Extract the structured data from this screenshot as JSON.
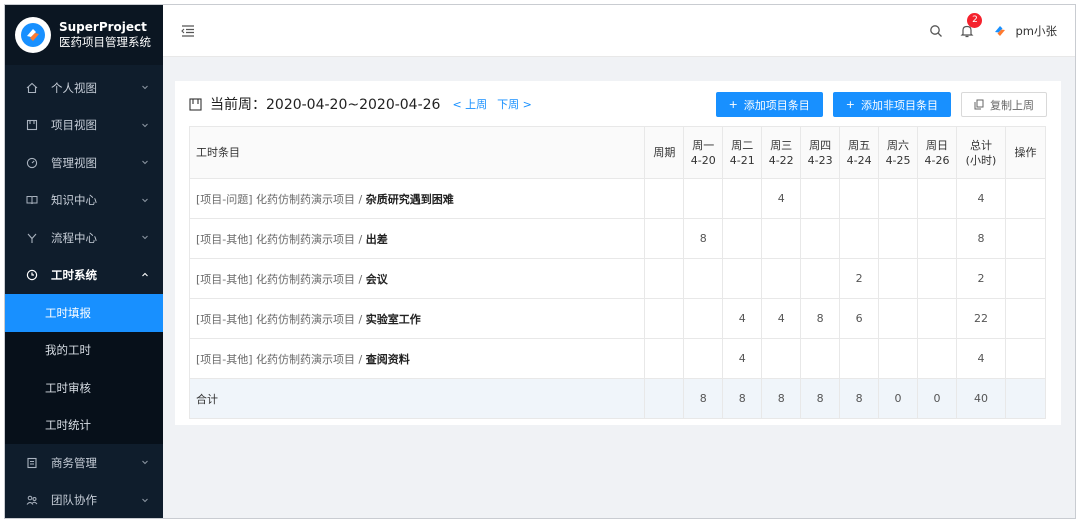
{
  "brand": {
    "title": "SuperProject",
    "subtitle": "医药项目管理系统"
  },
  "sidebar": {
    "items": [
      {
        "label": "个人视图",
        "icon": "home-icon"
      },
      {
        "label": "项目视图",
        "icon": "project-icon"
      },
      {
        "label": "管理视图",
        "icon": "dashboard-icon"
      },
      {
        "label": "知识中心",
        "icon": "book-icon"
      },
      {
        "label": "流程中心",
        "icon": "flow-icon"
      },
      {
        "label": "工时系统",
        "icon": "clock-icon"
      }
    ],
    "sub_items": [
      {
        "label": "工时填报"
      },
      {
        "label": "我的工时"
      },
      {
        "label": "工时审核"
      },
      {
        "label": "工时统计"
      }
    ],
    "bottom_items": [
      {
        "label": "商务管理",
        "icon": "business-icon"
      },
      {
        "label": "团队协作",
        "icon": "team-icon"
      }
    ]
  },
  "topbar": {
    "notification_count": "2",
    "user_name": "pm小张"
  },
  "week": {
    "label": "当前周：2020-04-20~2020-04-26",
    "prev": "< 上周",
    "next": "下周 >"
  },
  "buttons": {
    "add_project": "添加项目条目",
    "add_non_project": "添加非项目条目",
    "copy_last": "复制上周"
  },
  "table": {
    "headers": {
      "item": "工时条目",
      "period": "周期",
      "days": [
        {
          "day": "周一",
          "date": "4-20"
        },
        {
          "day": "周二",
          "date": "4-21"
        },
        {
          "day": "周三",
          "date": "4-22"
        },
        {
          "day": "周四",
          "date": "4-23"
        },
        {
          "day": "周五",
          "date": "4-24"
        },
        {
          "day": "周六",
          "date": "4-25"
        },
        {
          "day": "周日",
          "date": "4-26"
        }
      ],
      "total_line1": "总计",
      "total_line2": "(小时)",
      "action": "操作"
    },
    "rows": [
      {
        "prefix": "[项目-问题] 化药仿制药演示项目 / ",
        "title": "杂质研究遇到困难",
        "period": "",
        "hours": [
          "",
          "",
          "4",
          "",
          "",
          "",
          ""
        ],
        "total": "4"
      },
      {
        "prefix": "[项目-其他] 化药仿制药演示项目 / ",
        "title": "出差",
        "period": "",
        "hours": [
          "8",
          "",
          "",
          "",
          "",
          "",
          ""
        ],
        "total": "8"
      },
      {
        "prefix": "[项目-其他] 化药仿制药演示项目 / ",
        "title": "会议",
        "period": "",
        "hours": [
          "",
          "",
          "",
          "",
          "2",
          "",
          ""
        ],
        "total": "2"
      },
      {
        "prefix": "[项目-其他] 化药仿制药演示项目 / ",
        "title": "实验室工作",
        "period": "",
        "hours": [
          "",
          "4",
          "4",
          "8",
          "6",
          "",
          ""
        ],
        "total": "22"
      },
      {
        "prefix": "[项目-其他] 化药仿制药演示项目 / ",
        "title": "查阅资料",
        "period": "",
        "hours": [
          "",
          "4",
          "",
          "",
          "",
          "",
          ""
        ],
        "total": "4"
      }
    ],
    "summary": {
      "label": "合计",
      "hours": [
        "8",
        "8",
        "8",
        "8",
        "8",
        "0",
        "0"
      ],
      "total": "40"
    }
  }
}
